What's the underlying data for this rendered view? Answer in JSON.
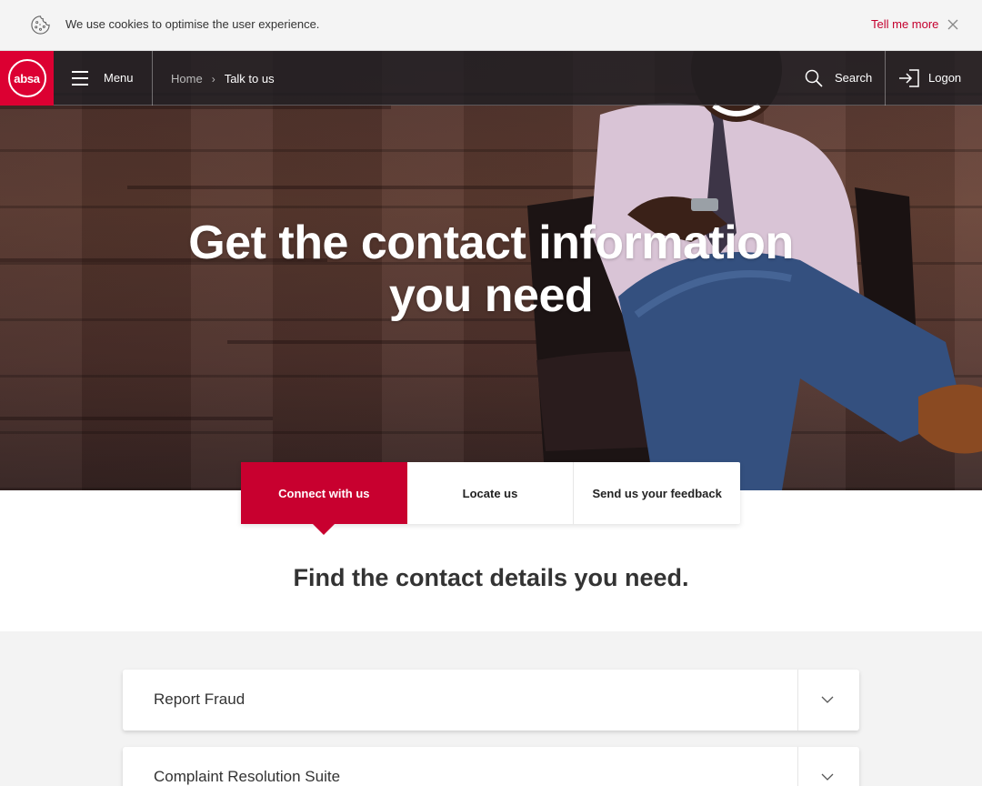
{
  "cookie_bar": {
    "message": "We use cookies to optimise the user experience.",
    "link_label": "Tell me more",
    "icon": "cookie-icon",
    "close_icon": "close-icon"
  },
  "nav": {
    "logo_text": "absa",
    "menu_label": "Menu",
    "breadcrumb": [
      "Home",
      "Talk to us"
    ],
    "search_label": "Search",
    "logon_label": "Logon"
  },
  "hero": {
    "title_line1": "Get the contact information",
    "title_line2": "you need"
  },
  "tabs": [
    {
      "label": "Connect with us",
      "active": true
    },
    {
      "label": "Locate us",
      "active": false
    },
    {
      "label": "Send us your feedback",
      "active": false
    }
  ],
  "section": {
    "heading": "Find the contact details you need."
  },
  "accordion": [
    {
      "title": "Report Fraud"
    },
    {
      "title": "Complaint Resolution Suite"
    }
  ],
  "colors": {
    "brand_red": "#dc0032",
    "active_tab": "#c8002f",
    "link_red": "#c4002e"
  }
}
